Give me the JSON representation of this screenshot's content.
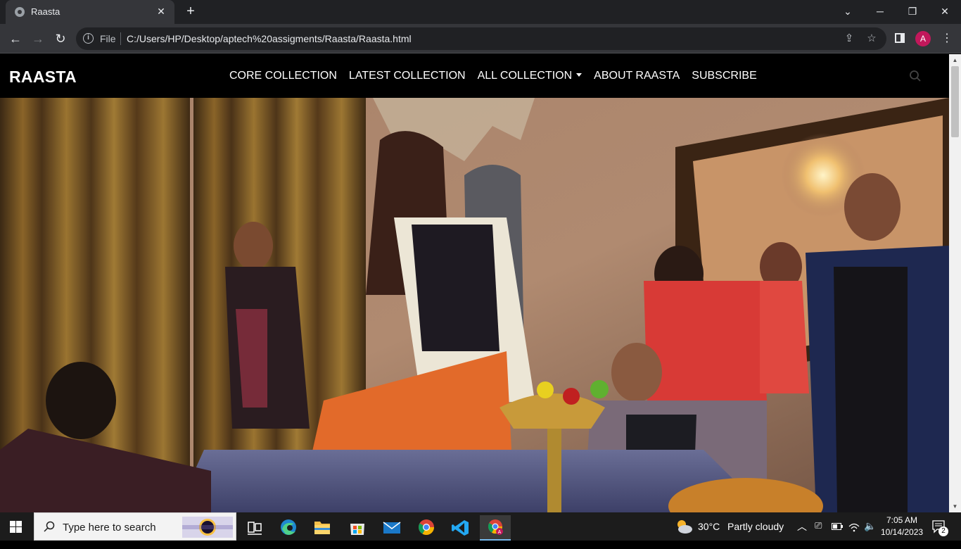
{
  "browser": {
    "tab_title": "Raasta",
    "new_tab_symbol": "+",
    "scheme_label": "File",
    "url": "C:/Users/HP/Desktop/aptech%20assigments/Raasta/Raasta.html",
    "profile_initial": "A"
  },
  "site": {
    "brand": "RAASTA",
    "nav": [
      {
        "label": "CORE COLLECTION"
      },
      {
        "label": "LATEST COLLECTION"
      },
      {
        "label": "ALL COLLECTION",
        "dropdown": true
      },
      {
        "label": "ABOUT RAASTA"
      },
      {
        "label": "SUBSCRIBE"
      }
    ],
    "hero_image": "fashion-group-photo"
  },
  "taskbar": {
    "search_placeholder": "Type here to search",
    "weather_temp": "30°C",
    "weather_desc": "Partly cloudy",
    "time": "7:05 AM",
    "date": "10/14/2023",
    "notification_count": "2"
  },
  "colors": {
    "tabbar": "#202124",
    "toolbar": "#35363a",
    "page_bg": "#000000",
    "profile": "#c2185b",
    "taskbar": "#1c1c1c"
  }
}
